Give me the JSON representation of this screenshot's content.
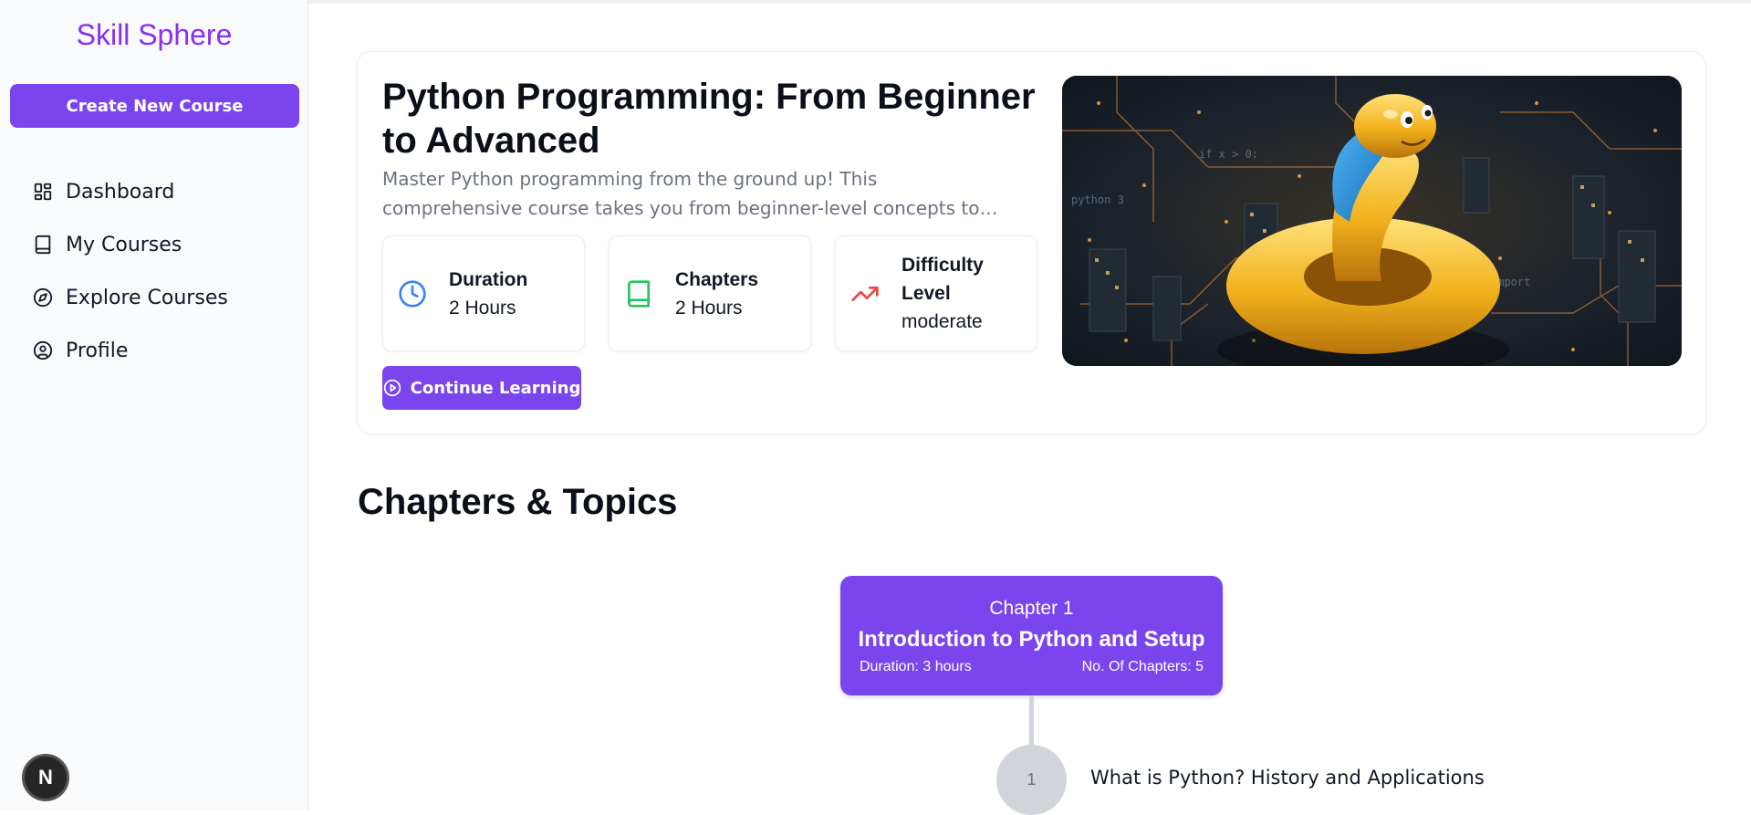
{
  "sidebar": {
    "brand": "Skill Sphere",
    "create_button": "Create New Course",
    "items": [
      {
        "label": "Dashboard",
        "icon": "dashboard-icon"
      },
      {
        "label": "My Courses",
        "icon": "book-icon"
      },
      {
        "label": "Explore Courses",
        "icon": "compass-icon"
      },
      {
        "label": "Profile",
        "icon": "user-circle-icon"
      }
    ],
    "badge": "N"
  },
  "course": {
    "title": "Python Programming: From Beginner to Advanced",
    "description": "Master Python programming from the ground up! This comprehensive course takes you from beginner-level concepts to advanced techniques, building real-world projects along the way.",
    "stats": [
      {
        "label": "Duration",
        "value": "2 Hours",
        "icon": "clock-icon",
        "color": "#3b82f6"
      },
      {
        "label": "Chapters",
        "value": "2 Hours",
        "icon": "book-icon",
        "color": "#22c55e"
      },
      {
        "label": "Difficulty Level",
        "value": "moderate",
        "icon": "trending-up-icon",
        "color": "#ef4444"
      }
    ],
    "continue_button": "Continue Learning"
  },
  "chapters_section": {
    "title": "Chapters & Topics",
    "chapter": {
      "number_label": "Chapter 1",
      "title": "Introduction to Python and Setup",
      "duration": "Duration: 3 hours",
      "count": "No. Of Chapters: 5"
    },
    "topics": [
      {
        "number": "1",
        "title": "What is Python? History and Applications"
      }
    ]
  },
  "colors": {
    "accent": "#7b45ee",
    "brand": "#8b2ff0"
  }
}
